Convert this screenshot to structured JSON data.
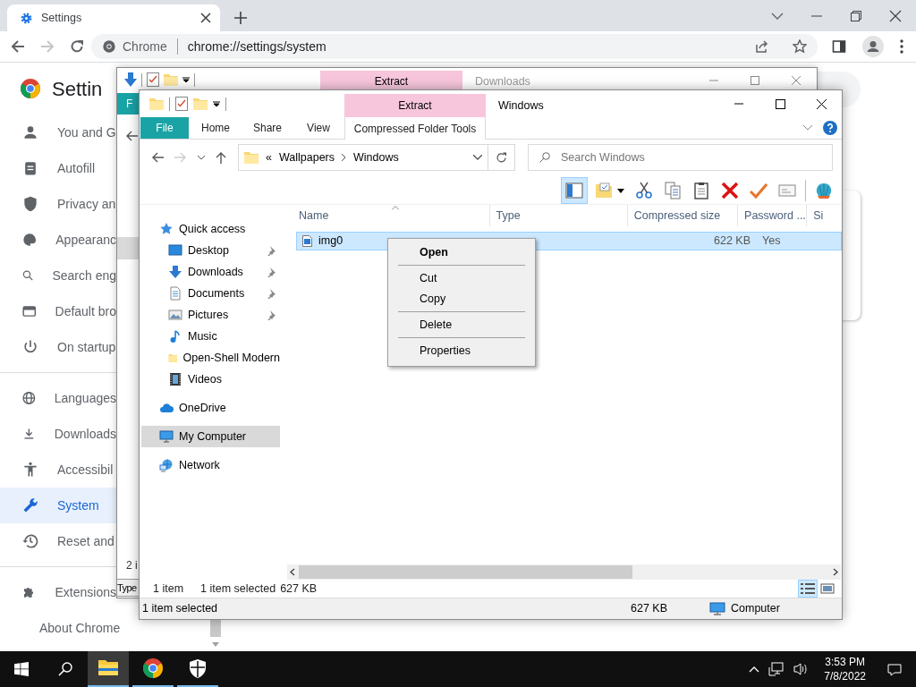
{
  "browser": {
    "tab_title": "Settings",
    "site_chip": "Chrome",
    "url": "chrome://settings/system",
    "forward_disabled": true,
    "heading": "Settin",
    "nav_sections": [
      {
        "items": [
          {
            "label": "You and G",
            "selected": false
          },
          {
            "label": "Autofill",
            "selected": false
          },
          {
            "label": "Privacy an",
            "selected": false
          },
          {
            "label": "Appearanc",
            "selected": false
          },
          {
            "label": "Search eng",
            "selected": false
          },
          {
            "label": "Default bro",
            "selected": false
          },
          {
            "label": "On startup",
            "selected": false
          }
        ]
      },
      {
        "items": [
          {
            "label": "Languages",
            "selected": false
          },
          {
            "label": "Downloads",
            "selected": false
          },
          {
            "label": "Accessibil",
            "selected": false
          },
          {
            "label": "System",
            "selected": true
          },
          {
            "label": "Reset and",
            "selected": false
          }
        ]
      },
      {
        "items": [
          {
            "label": "Extensions",
            "selected": false
          },
          {
            "label": "About Chrome",
            "selected": false
          }
        ]
      }
    ]
  },
  "back_window": {
    "title": "Downloads",
    "context_header": "Extract",
    "file_tab": "F",
    "status": "2 i",
    "column": "Type"
  },
  "front_window": {
    "title": "Windows",
    "context_header": "Extract",
    "ribbon_tabs": [
      {
        "label": "File",
        "kind": "file"
      },
      {
        "label": "Home",
        "kind": "tab"
      },
      {
        "label": "Share",
        "kind": "tab"
      },
      {
        "label": "View",
        "kind": "tab"
      },
      {
        "label": "Compressed Folder Tools",
        "kind": "context"
      }
    ],
    "forward_disabled": true,
    "address_prefix": "«",
    "breadcrumbs": [
      "Wallpapers",
      "Windows"
    ],
    "search": {
      "placeholder": "Search Windows"
    },
    "toolbar_buttons": [
      {
        "selected": true
      },
      {
        "selected": false
      },
      {
        "selected": false
      },
      {
        "selected": false
      },
      {
        "selected": false
      },
      {
        "selected": false
      },
      {
        "selected": false
      },
      {
        "selected": false
      },
      {
        "selected": false
      }
    ],
    "navigation_pane": [
      {
        "label": "Quick access",
        "selected": false,
        "children": [
          {
            "label": "Desktop",
            "selected": false,
            "pinned": true
          },
          {
            "label": "Downloads",
            "selected": false,
            "pinned": true
          },
          {
            "label": "Documents",
            "selected": false,
            "pinned": true
          },
          {
            "label": "Pictures",
            "selected": false,
            "pinned": true
          },
          {
            "label": "Music",
            "selected": false,
            "pinned": false
          },
          {
            "label": "Open-Shell Modern",
            "selected": false,
            "pinned": false
          },
          {
            "label": "Videos",
            "selected": false,
            "pinned": false
          }
        ]
      },
      {
        "label": "OneDrive",
        "selected": false
      },
      {
        "label": "My Computer",
        "selected": true
      },
      {
        "label": "Network",
        "selected": false
      }
    ],
    "columns": [
      "Name",
      "Type",
      "Compressed size",
      "Password ...",
      "Si"
    ],
    "files": [
      {
        "name": "img0",
        "compressed_size": "622 KB",
        "password": "Yes",
        "selected": true
      }
    ],
    "context_menu": [
      {
        "kind": "item",
        "label": "Open",
        "default": true
      },
      {
        "kind": "separator"
      },
      {
        "kind": "item",
        "label": "Cut",
        "default": false
      },
      {
        "kind": "item",
        "label": "Copy",
        "default": false
      },
      {
        "kind": "separator"
      },
      {
        "kind": "item",
        "label": "Delete",
        "default": false
      },
      {
        "kind": "separator"
      },
      {
        "kind": "item",
        "label": "Properties",
        "default": false
      }
    ],
    "status": {
      "count": "1 item",
      "selection": "1 item selected",
      "size": "627 KB"
    },
    "view_buttons": [
      {
        "selected": true
      },
      {
        "selected": false
      }
    ],
    "status_bar": {
      "selection": "1 item selected",
      "size": "627 KB",
      "location": "Computer"
    }
  },
  "taskbar": {
    "apps": [
      {
        "selected": true
      },
      {
        "selected": false
      },
      {
        "selected": false
      }
    ],
    "time": "3:53 PM",
    "date": "7/8/2022"
  }
}
